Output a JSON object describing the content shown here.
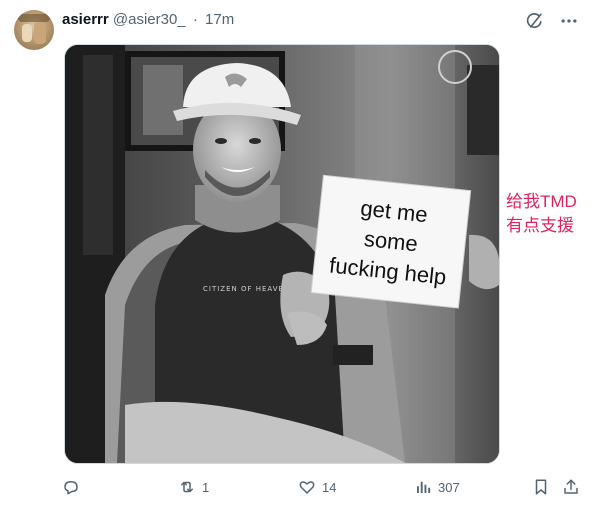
{
  "post": {
    "author_name": "asierrr",
    "author_handle": "@asier30_",
    "separator": "·",
    "time": "17m"
  },
  "media": {
    "sign_lines": [
      "get me",
      "some",
      "fucking help"
    ],
    "hoodie_text": "CITIZEN OF HEAVEN"
  },
  "side_text": {
    "line1": "给我TMD",
    "line2": "有点支援"
  },
  "actions": {
    "reply_count": "",
    "repost_count": "1",
    "like_count": "14",
    "views_count": "307"
  },
  "icons": {
    "grok": "grok-icon",
    "more": "more-icon",
    "reply": "reply-icon",
    "repost": "repost-icon",
    "like": "heart-icon",
    "views": "views-icon",
    "bookmark": "bookmark-icon",
    "share": "share-icon"
  },
  "colors": {
    "text_primary": "#0f1419",
    "text_secondary": "#536471",
    "side_text": "#e0245e",
    "border": "#cfd9de"
  }
}
